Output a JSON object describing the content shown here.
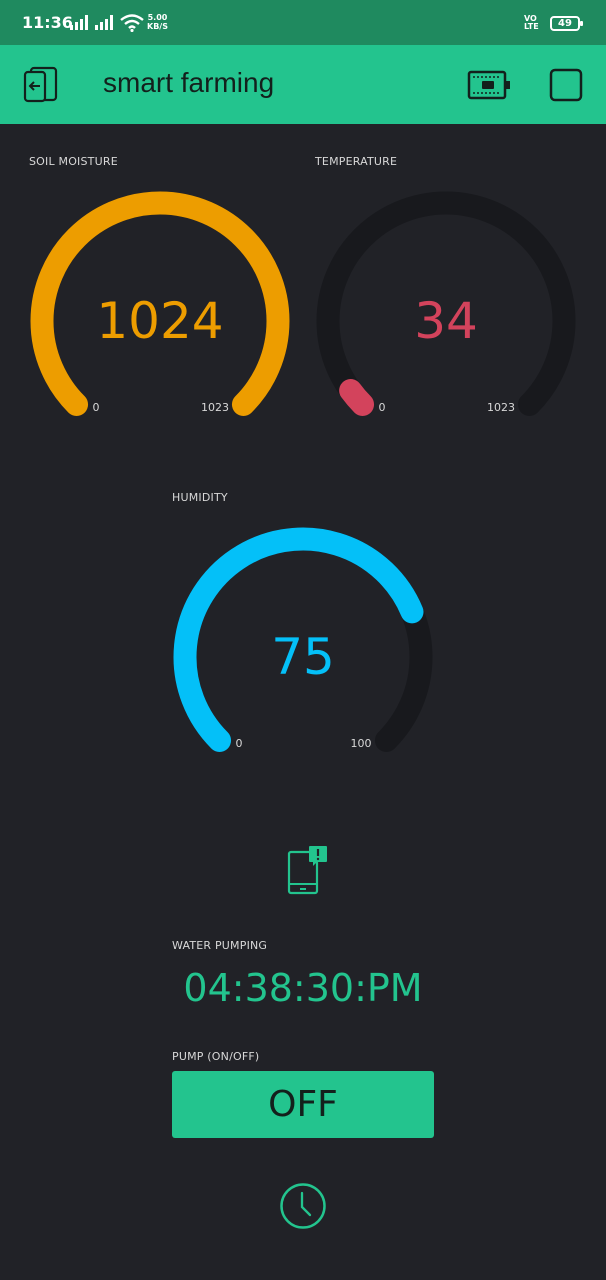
{
  "status_bar": {
    "time": "11:36",
    "net_speed_value": "5.00",
    "net_speed_unit": "KB/S",
    "volte_line1": "VO",
    "volte_line2": "LTE",
    "battery": "49",
    "icons": [
      "signal-icon",
      "signal-icon",
      "wifi-icon",
      "battery-icon"
    ]
  },
  "header": {
    "title": "smart farming",
    "icons": [
      "back-icon",
      "device-icon",
      "stop-icon"
    ]
  },
  "gauges": {
    "soil": {
      "label": "SOIL MOISTURE",
      "value": "1024",
      "min": "0",
      "max": "1023",
      "fraction": 1.0,
      "color": "#ED9D00"
    },
    "temp": {
      "label": "TEMPERATURE",
      "value": "34",
      "min": "0",
      "max": "1023",
      "fraction": 0.033,
      "color": "#D3435C"
    },
    "humidity": {
      "label": "HUMIDITY",
      "value": "75",
      "min": "0",
      "max": "100",
      "fraction": 0.75,
      "color": "#04C0F8"
    }
  },
  "notification": {
    "icon": "notification-icon"
  },
  "timer": {
    "label": "WATER PUMPING",
    "value": "04:38:30:PM"
  },
  "pump": {
    "label": "PUMP (ON/OFF)",
    "button_label": "OFF"
  },
  "clock": {
    "icon": "clock-icon"
  },
  "colors": {
    "accent": "#23C48E",
    "background": "#212227",
    "track": "#18191D",
    "status_bar": "#1F8A5F"
  }
}
